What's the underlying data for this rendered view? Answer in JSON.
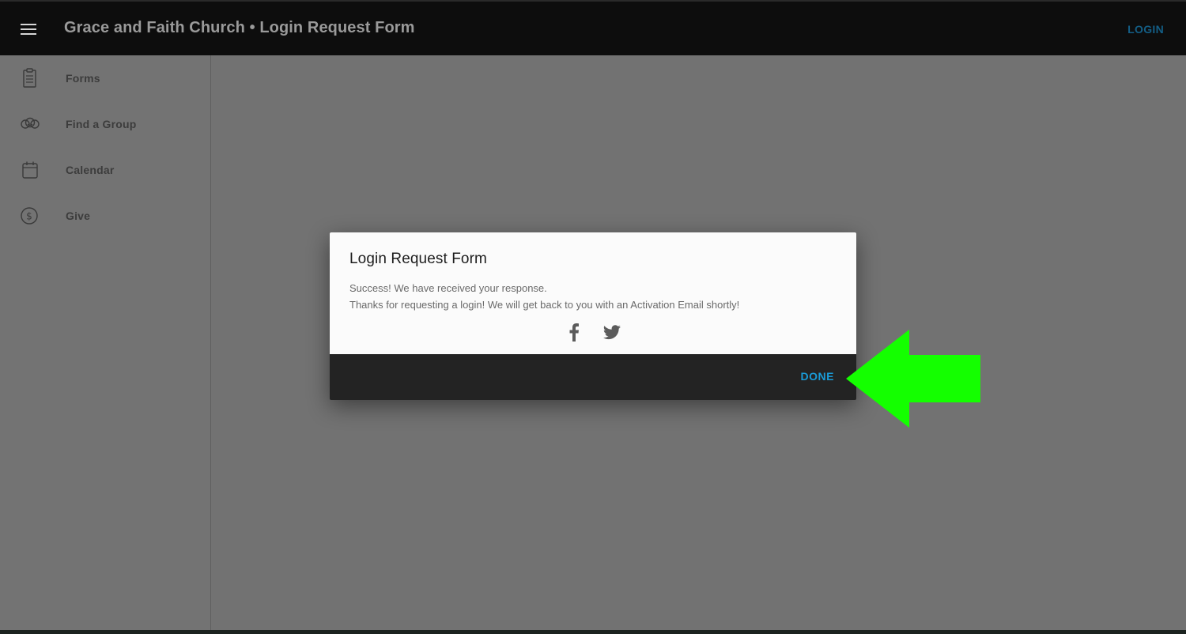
{
  "header": {
    "title": "Grace and Faith Church • Login Request Form",
    "login_label": "LOGIN",
    "menu_icon": "hamburger-menu-icon"
  },
  "sidebar": {
    "items": [
      {
        "label": "Forms",
        "icon": "clipboard-icon"
      },
      {
        "label": "Find a Group",
        "icon": "group-icon"
      },
      {
        "label": "Calendar",
        "icon": "calendar-icon"
      },
      {
        "label": "Give",
        "icon": "dollar-circle-icon"
      }
    ]
  },
  "dialog": {
    "title": "Login Request Form",
    "message_line1": "Success! We have received your response.",
    "message_line2": "Thanks for requesting a login! We will get back to you with an Activation Email shortly!",
    "share_icons": [
      "facebook-icon",
      "twitter-icon"
    ],
    "done_label": "DONE"
  },
  "annotation": {
    "arrow_color": "#14ff00",
    "arrow_direction": "left"
  },
  "colors": {
    "topbar": "#0d0d0d",
    "sidebar": "#737373",
    "overlay": "#727272",
    "accent": "#1a9bd7"
  }
}
